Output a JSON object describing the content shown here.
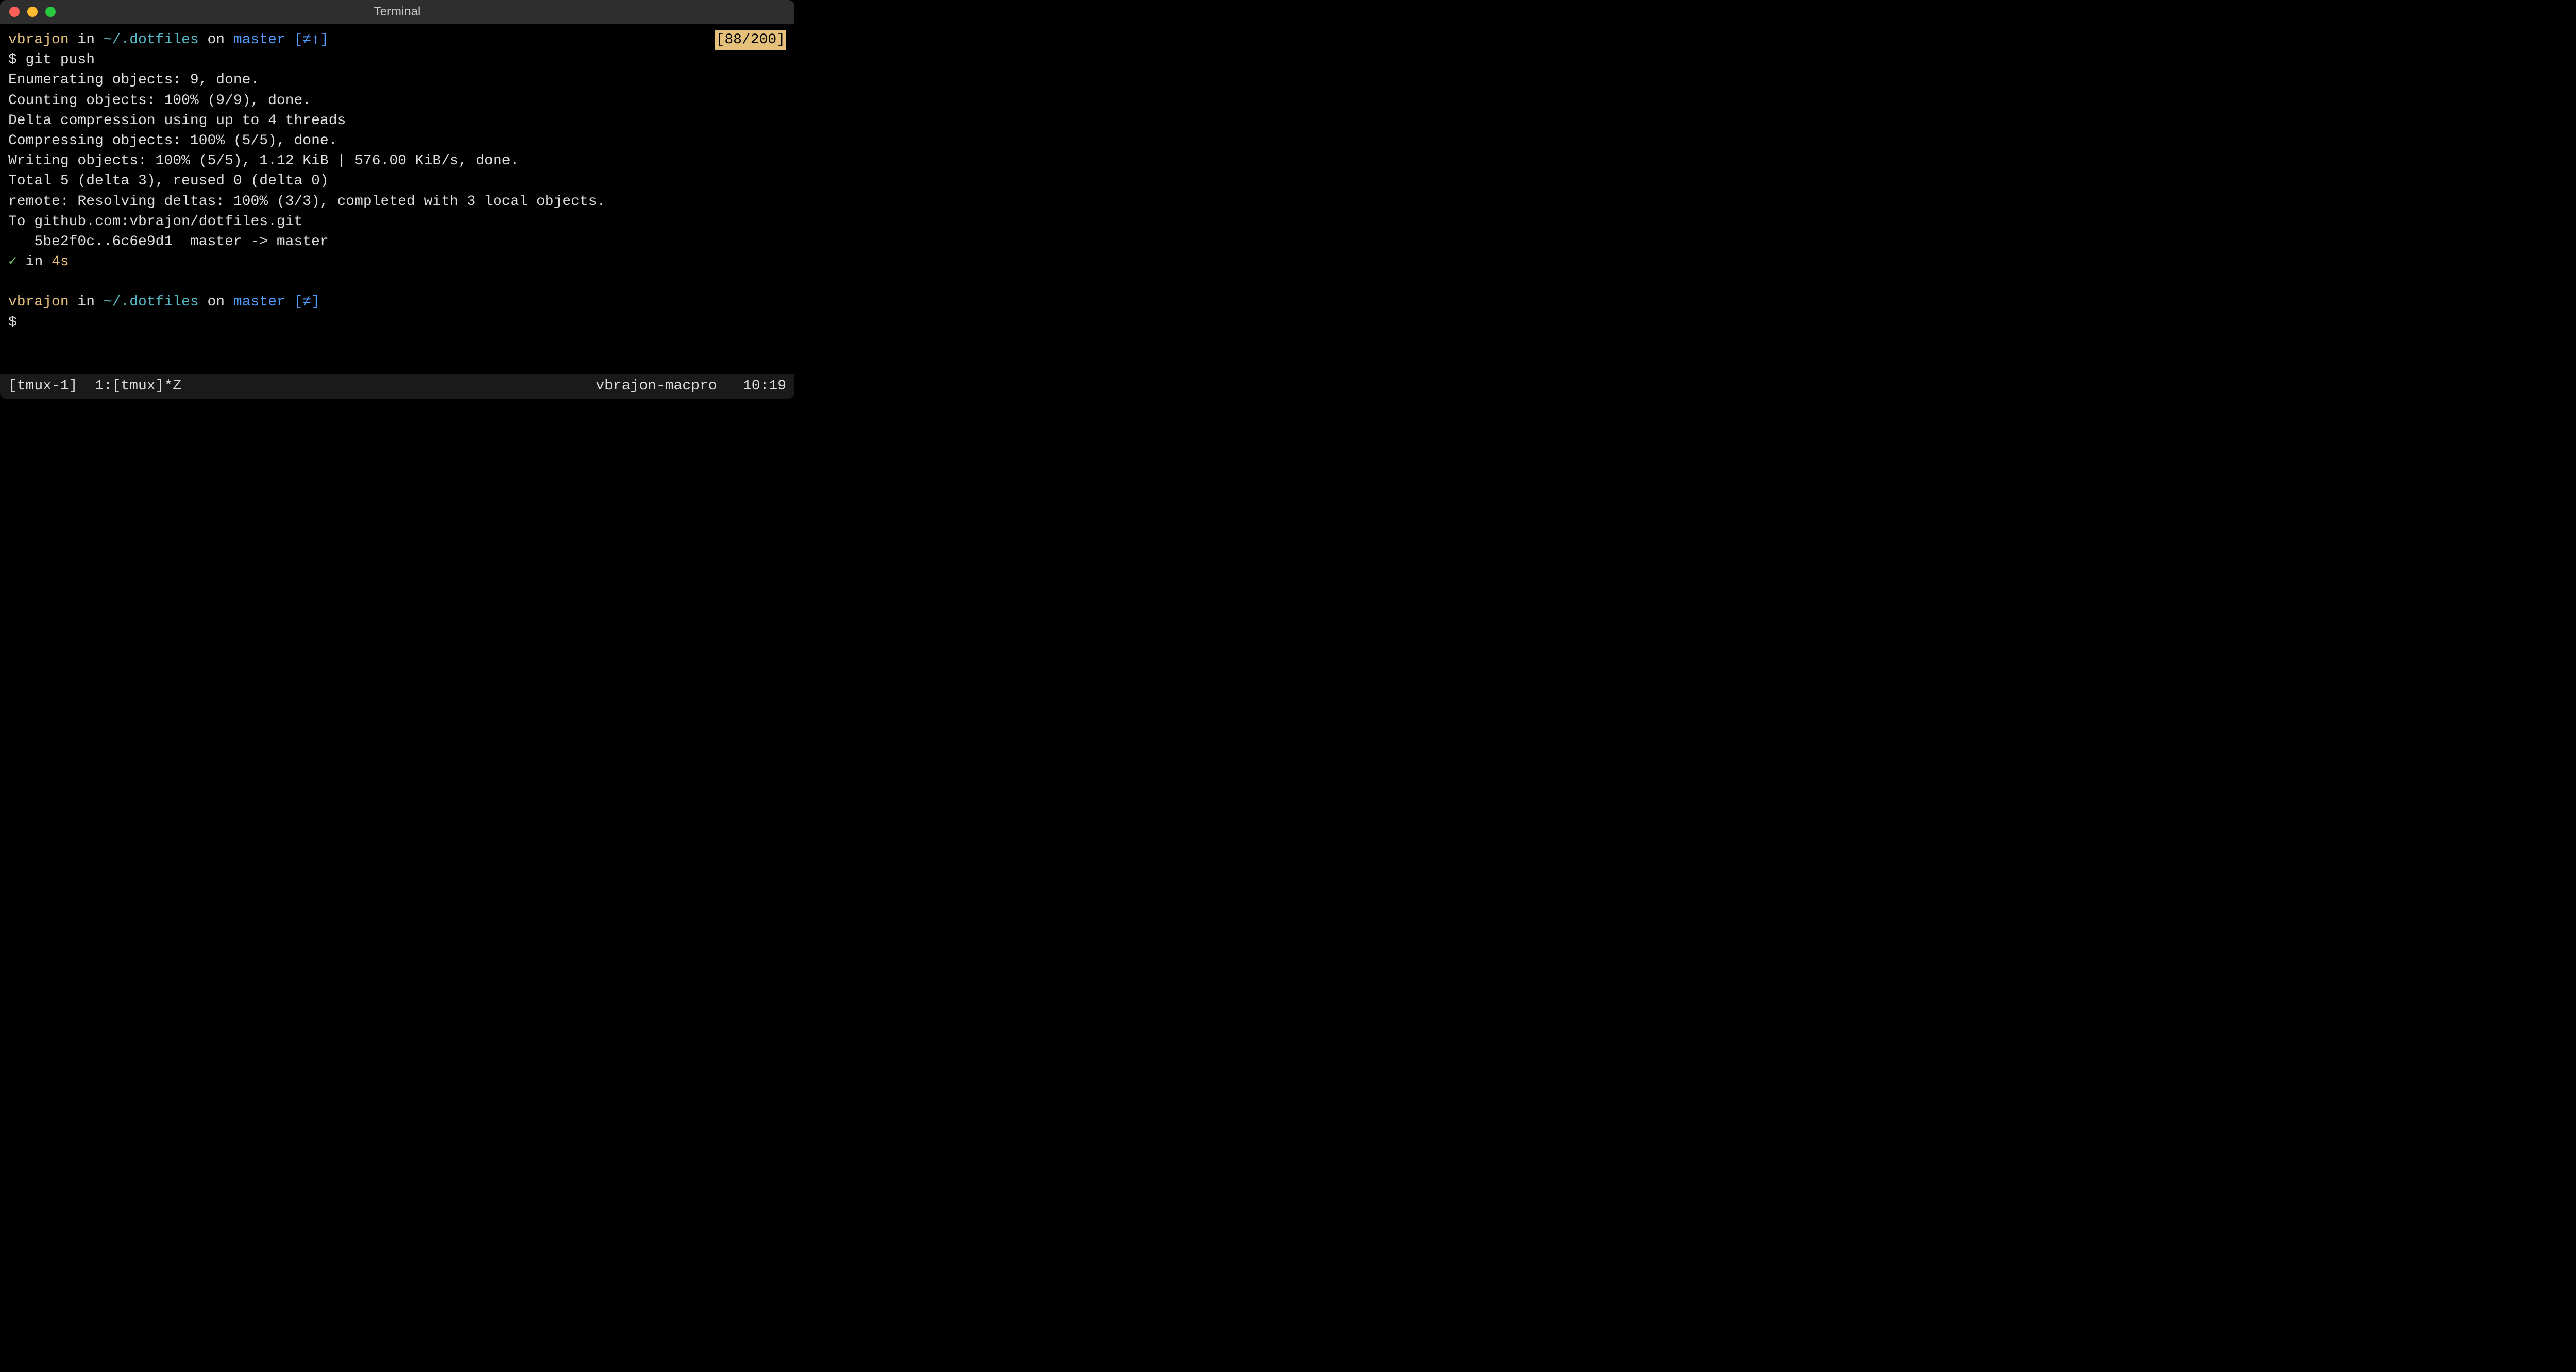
{
  "window": {
    "title": "Terminal"
  },
  "history_badge": "[88/200]",
  "prompt1": {
    "user": "vbrajon",
    "sep1": " in ",
    "path": "~/.dotfiles",
    "sep2": " on ",
    "branch": "master",
    "status": " [≠↑]"
  },
  "cmd1": "$ git push",
  "output": [
    "Enumerating objects: 9, done.",
    "Counting objects: 100% (9/9), done.",
    "Delta compression using up to 4 threads",
    "Compressing objects: 100% (5/5), done.",
    "Writing objects: 100% (5/5), 1.12 KiB | 576.00 KiB/s, done.",
    "Total 5 (delta 3), reused 0 (delta 0)",
    "remote: Resolving deltas: 100% (3/3), completed with 3 local objects.",
    "To github.com:vbrajon/dotfiles.git",
    "   5be2f0c..6c6e9d1  master -> master"
  ],
  "result": {
    "check": "✓",
    "sep": " in ",
    "duration": "4s"
  },
  "prompt2": {
    "user": "vbrajon",
    "sep1": " in ",
    "path": "~/.dotfiles",
    "sep2": " on ",
    "branch": "master",
    "status": " [≠]"
  },
  "cmd2": "$ ",
  "tmux": {
    "left": "[tmux-1]  1:[tmux]*Z",
    "host": "vbrajon-macpro",
    "time": "10:19"
  }
}
